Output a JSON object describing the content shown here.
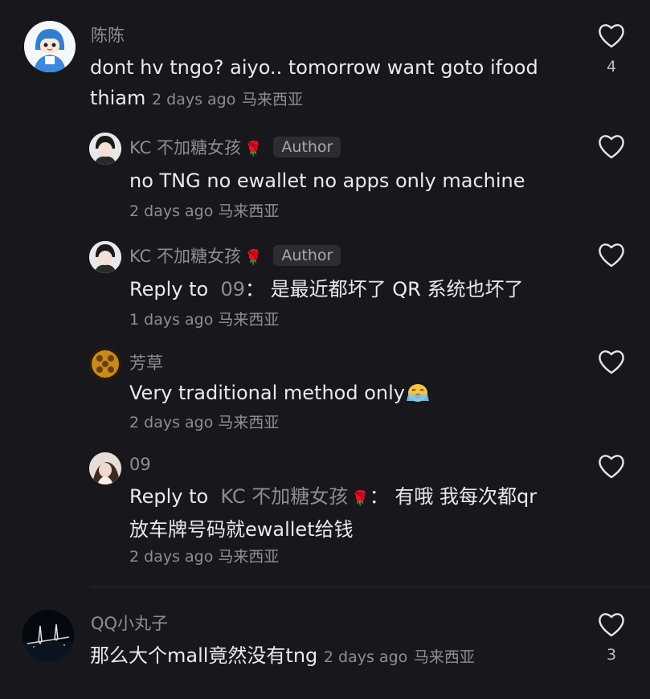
{
  "comments": [
    {
      "username": "陈陈",
      "text_line1": "dont hv tngo? aiyo.. tomorrow want goto ifood",
      "text_line2": "thiam",
      "time": "2 days ago",
      "location": "马来西亚",
      "likes": "4"
    },
    {
      "username": "QQ小丸子",
      "text": "那么大个mall竟然没有tng",
      "time": "2 days ago",
      "location": "马来西亚",
      "likes": "3"
    }
  ],
  "replies": [
    {
      "username": "KC 不加糖女孩",
      "badge": "Author",
      "text": "no TNG no ewallet no apps only machine",
      "time": "2 days ago",
      "location": "马来西亚"
    },
    {
      "username": "KC 不加糖女孩",
      "badge": "Author",
      "reply_prefix": "Reply to",
      "reply_target": "09",
      "text": "：  是最近都坏了 QR 系统也坏了",
      "time": "1 days ago",
      "location": "马来西亚"
    },
    {
      "username": "芳草",
      "text": "Very traditional method only",
      "time": "2 days ago",
      "location": "马来西亚"
    },
    {
      "username": "09",
      "reply_prefix": "Reply to",
      "reply_target": "KC 不加糖女孩",
      "text": "：  有哦 我每次都qr",
      "text_line2": "放车牌号码就ewallet给钱",
      "time": "2 days ago",
      "location": "马来西亚"
    }
  ],
  "colors": {
    "background": "#17171c",
    "text": "#e9e9ee",
    "muted": "#8d8d94",
    "rose": "#d11a2a"
  },
  "icons": {
    "like": "heart-outline-icon",
    "rose": "rose-icon",
    "crying": "crying-face-icon"
  }
}
